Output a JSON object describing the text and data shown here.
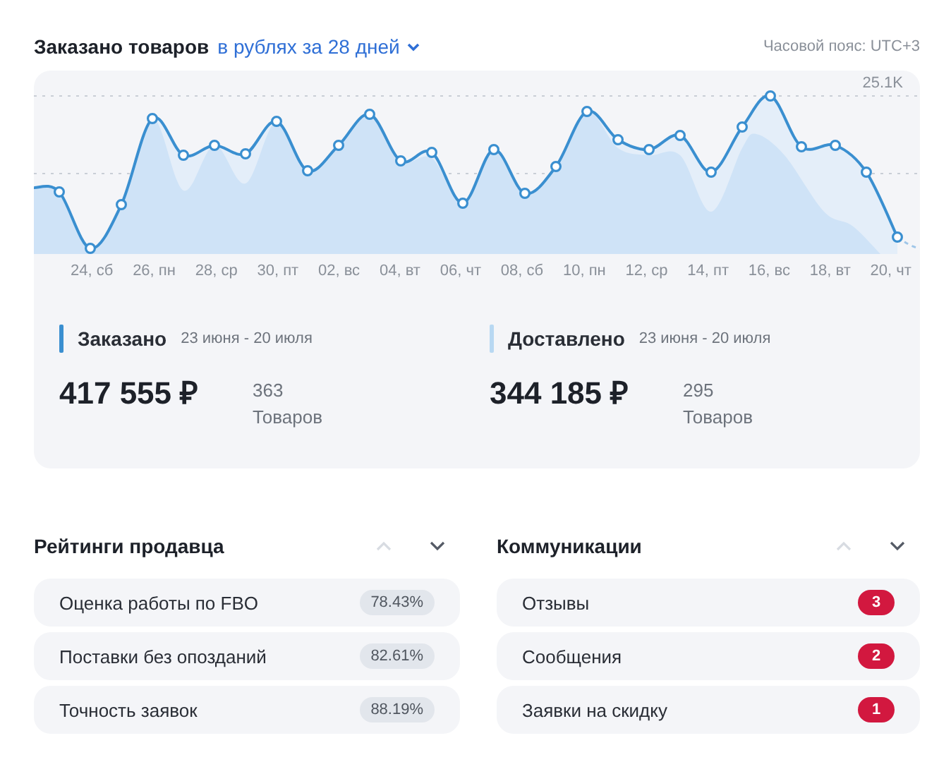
{
  "header": {
    "title": "Заказано товаров",
    "period": "в рублях за 28 дней",
    "timezone": "Часовой пояс: UTC+3"
  },
  "chart": {
    "max_label": "25.1K",
    "x_labels": [
      "24, сб",
      "26, пн",
      "28, ср",
      "30, пт",
      "02, вс",
      "04, вт",
      "06, чт",
      "08, сб",
      "10, пн",
      "12, ср",
      "14, пт",
      "16, вс",
      "18, вт",
      "20, чт"
    ]
  },
  "summary": [
    {
      "title": "Заказано",
      "dates": "23 июня - 20 июля",
      "amount": "417 555 ₽",
      "count": "363",
      "count_label": "Товаров",
      "color": "#3a8fd0"
    },
    {
      "title": "Доставлено",
      "dates": "23 июня - 20 июля",
      "amount": "344 185 ₽",
      "count": "295",
      "count_label": "Товаров",
      "color": "#b8d8f2"
    }
  ],
  "sections": [
    {
      "title": "Рейтинги продавца",
      "items": [
        {
          "label": "Оценка работы по FBO",
          "value": "78.43%",
          "kind": "percent"
        },
        {
          "label": "Поставки без опозданий",
          "value": "82.61%",
          "kind": "percent"
        },
        {
          "label": "Точность заявок",
          "value": "88.19%",
          "kind": "percent"
        }
      ]
    },
    {
      "title": "Коммуникации",
      "items": [
        {
          "label": "Отзывы",
          "value": "3",
          "kind": "count"
        },
        {
          "label": "Сообщения",
          "value": "2",
          "kind": "count"
        },
        {
          "label": "Заявки на скидку",
          "value": "1",
          "kind": "count"
        }
      ]
    }
  ]
}
